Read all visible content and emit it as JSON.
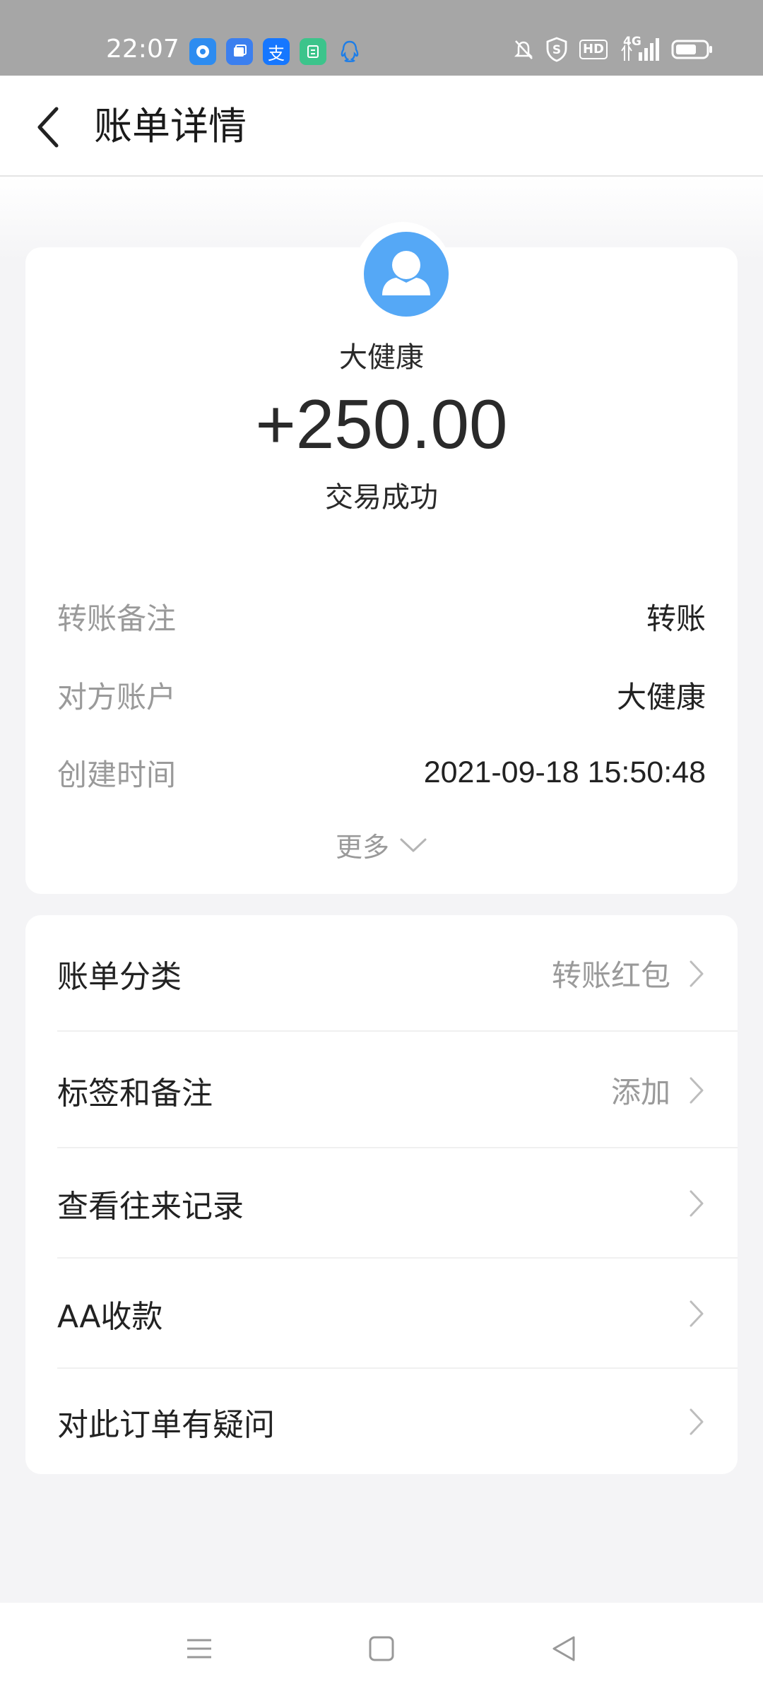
{
  "status_bar": {
    "time": "22:07",
    "app_icons": [
      {
        "name": "circle-app-icon",
        "color": "#2d8cf0"
      },
      {
        "name": "square-app-icon",
        "color": "#3b7fef"
      },
      {
        "name": "alipay-icon",
        "color": "#1677ff",
        "glyph": "支"
      },
      {
        "name": "green-app-icon",
        "color": "#3cc48b"
      },
      {
        "name": "qq-icon",
        "color": "#1e90ff"
      }
    ],
    "right_icons": [
      "mute-icon",
      "shield-icon",
      "hd-icon",
      "signal-4g-icon",
      "battery-icon"
    ],
    "hd_text": "HD",
    "network_text": "4G"
  },
  "header": {
    "title": "账单详情"
  },
  "transaction": {
    "payee": "大健康",
    "amount": "+250.00",
    "status": "交易成功",
    "details": [
      {
        "label": "转账备注",
        "value": "转账"
      },
      {
        "label": "对方账户",
        "value": "大健康"
      },
      {
        "label": "创建时间",
        "value": "2021-09-18 15:50:48"
      }
    ],
    "more_label": "更多"
  },
  "actions": [
    {
      "label": "账单分类",
      "value": "转账红包"
    },
    {
      "label": "标签和备注",
      "value": "添加"
    },
    {
      "label": "查看往来记录",
      "value": ""
    },
    {
      "label": "AA收款",
      "value": ""
    },
    {
      "label": "对此订单有疑问",
      "value": ""
    }
  ],
  "colors": {
    "avatar_bg": "#55a8f6",
    "status_bar_bg": "#a6a6a6",
    "page_bg": "#f4f4f6"
  }
}
